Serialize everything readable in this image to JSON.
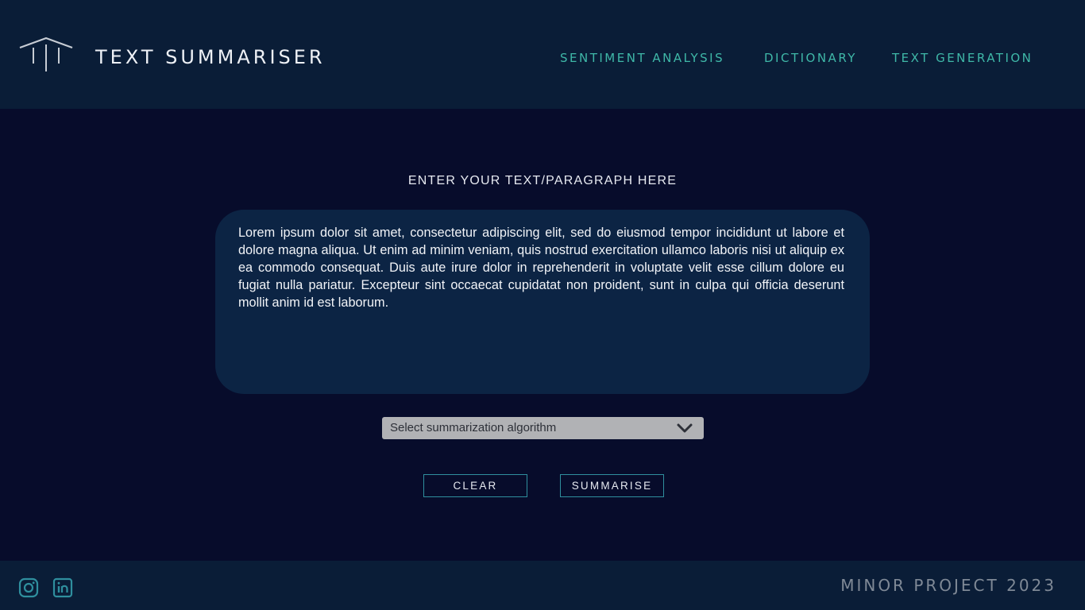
{
  "header": {
    "logo_icon": "pillars-logo-icon",
    "title": "TEXT SUMMARISER",
    "nav": [
      {
        "label": "SENTIMENT ANALYSIS"
      },
      {
        "label": "DICTIONARY"
      },
      {
        "label": "TEXT GENERATION"
      }
    ]
  },
  "main": {
    "prompt": "ENTER YOUR TEXT/PARAGRAPH HERE",
    "textarea_value": "Lorem ipsum dolor sit amet, consectetur adipiscing elit, sed do eiusmod tempor incididunt ut labore et dolore magna aliqua. Ut enim ad minim veniam, quis nostrud exercitation ullamco laboris nisi ut aliquip ex ea commodo consequat. Duis aute irure dolor in reprehenderit in voluptate velit esse cillum dolore eu fugiat nulla pariatur. Excepteur sint occaecat cupidatat non proident, sunt in culpa qui officia deserunt mollit anim id est laborum.",
    "select": {
      "placeholder": "Select summarization algorithm",
      "icon": "chevron-down-icon"
    },
    "buttons": {
      "clear": "CLEAR",
      "summarise": "SUMMARISE"
    }
  },
  "footer": {
    "social_icons": [
      "instagram-icon",
      "linkedin-icon"
    ],
    "text": "MINOR PROJECT 2023"
  },
  "colors": {
    "background": "#070c2b",
    "header_bg": "#0a1d37",
    "nav_accent": "#3fb8a8",
    "textbox_bg": "#0c2444",
    "button_border": "#2f8f9e",
    "select_bg": "#b1b2b5"
  }
}
